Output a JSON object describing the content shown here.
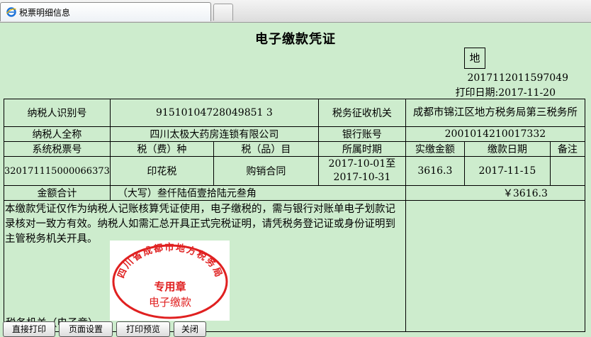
{
  "tab": {
    "title": "税票明细信息"
  },
  "doc": {
    "title": "电子缴款凭证",
    "region_mark": "地",
    "serial": "2017112011597049",
    "print_date": "打印日期:2017-11-20"
  },
  "table": {
    "taxpayer_id_label": "纳税人识别号",
    "taxpayer_id": "91510104728049851 3",
    "authority_label": "税务征收机关",
    "authority": "成都市锦江区地方税务局第三税务所",
    "taxpayer_name_label": "纳税人全称",
    "taxpayer_name": "四川太极大药房连锁有限公司",
    "bank_label": "银行账号",
    "bank_account": "2001014210017332",
    "headers": [
      "系统税票号",
      "税（费）种",
      "税（品）目",
      "所属时期",
      "实缴金额",
      "缴款日期",
      "备注"
    ],
    "row": {
      "ticket_no": "320171115000066373",
      "tax_type": "印花税",
      "item": "购销合同",
      "period_from": "2017-10-01至",
      "period_to": "2017-10-31",
      "amount": "3616.3",
      "pay_date": "2017-11-15",
      "remark": ""
    },
    "total_label": "金额合计",
    "total_words": "（大写）叁仟陆佰壹拾陆元叁角",
    "total_amount": "￥3616.3",
    "note": "本缴款凭证仅作为纳税人记账核算凭证使用，电子缴税的，需与银行对账单电子划款记录核对一致方有效。纳税人如需汇总开具正式完税证明，请凭税务登记证或身份证明到主管税务机关开具。",
    "seal_label": "税务机关（电子章）"
  },
  "seal": {
    "ring_text": "四川省成都市地方税务局",
    "center_text": "专用章",
    "bottom_text": "电子缴款",
    "color": "#e02020"
  },
  "buttons": [
    "直接打印",
    "页面设置",
    "打印预览",
    "关闭"
  ]
}
